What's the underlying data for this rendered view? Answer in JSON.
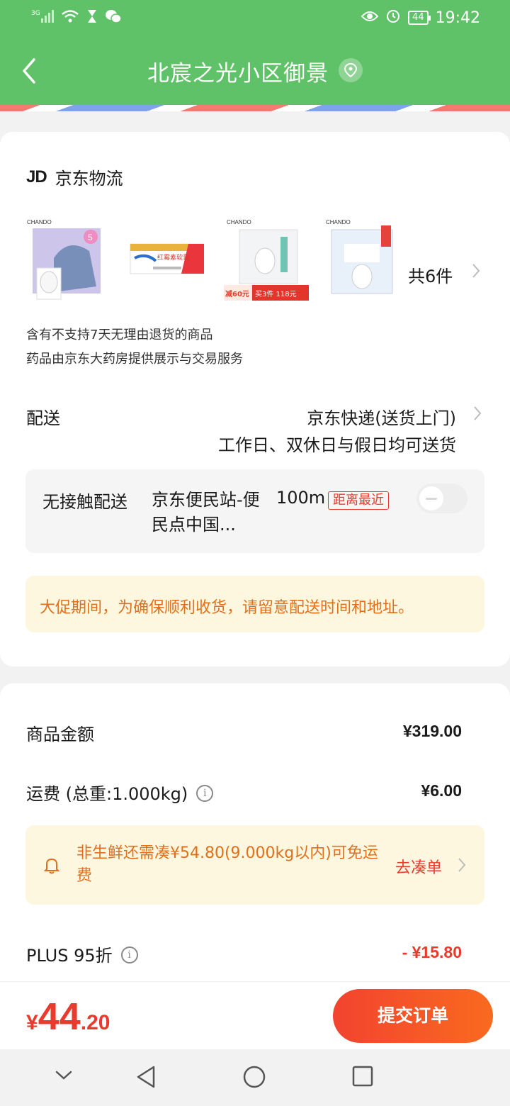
{
  "status_bar": {
    "signal": "3G",
    "time": "19:42",
    "battery": "44",
    "icons": [
      "signal-icon",
      "wifi-icon",
      "hourglass-icon",
      "wechat-icon",
      "eye-icon",
      "alarm-icon",
      "battery-icon"
    ]
  },
  "header": {
    "title": "北宸之光小区御景",
    "back_icon": "chevron-left-icon",
    "location_icon": "location-pin-icon",
    "bg_color": "#60c268"
  },
  "store": {
    "logo": "JD",
    "carrier": "京东物流"
  },
  "products": {
    "items": [
      {
        "brand": "CHANDO",
        "badge": "5"
      },
      {
        "brand": "红霉素软膏"
      },
      {
        "brand": "CHANDO",
        "promo_left": "减60元",
        "promo_right": "买3件 118元"
      },
      {
        "brand": "CHANDO"
      }
    ],
    "count_label": "共6件"
  },
  "notices": {
    "no_return": "含有不支持7天无理由退货的商品",
    "pharmacy": "药品由京东大药房提供展示与交易服务"
  },
  "delivery": {
    "label": "配送",
    "method": "京东快递(送货上门)",
    "schedule": "工作日、双休日与假日均可送货"
  },
  "contactless": {
    "label": "无接触配送",
    "station": "京东便民站-便民点中国...",
    "distance": "100m",
    "badge": "距离最近",
    "enabled": false
  },
  "promo_notice": "大促期间，为确保顺利收货，请留意配送时间和地址。",
  "summary": {
    "goods_label": "商品金额",
    "goods_value": "¥319.00",
    "freight_label": "运费 (总重:1.000kg)",
    "freight_value": "¥6.00",
    "freight_tip": "非生鲜还需凑¥54.80(9.000kg以内)可免运费",
    "freight_tip_link": "去凑单",
    "plus_label": "PLUS 95折",
    "plus_value": "- ¥15.80"
  },
  "footer": {
    "currency": "¥",
    "total_int": "44",
    "total_dec": ".20",
    "submit_label": "提交订单",
    "accent_color": "#e93b2d"
  },
  "system_nav": [
    "down-chevron-icon",
    "back-triangle-icon",
    "home-circle-icon",
    "recents-square-icon"
  ]
}
